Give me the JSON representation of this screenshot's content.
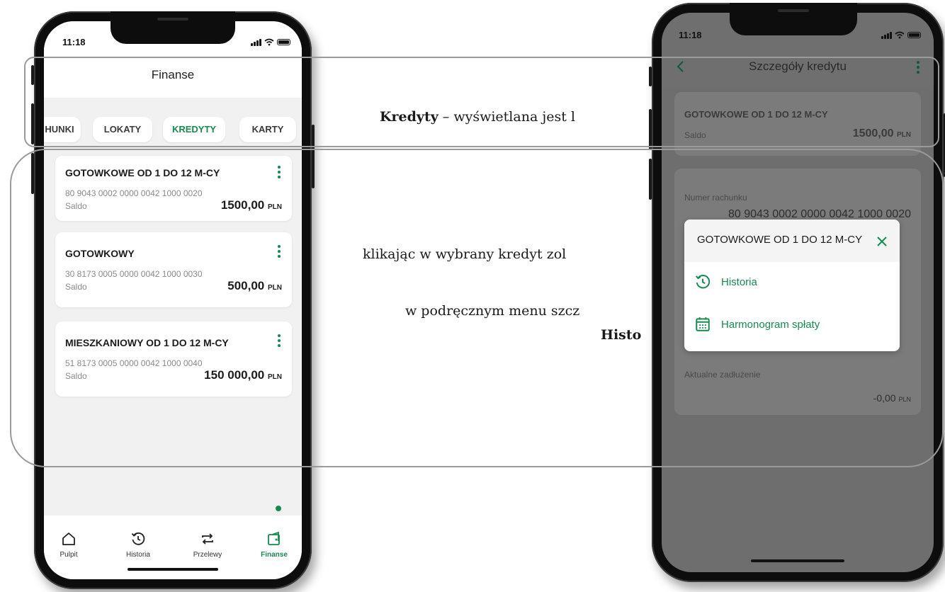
{
  "phone_left": {
    "time": "11:18",
    "title": "Finanse",
    "tabs": [
      "HUNKI",
      "LOKATY",
      "KREDYTY",
      "KARTY"
    ],
    "active_tab": "KREDYTY",
    "cards": [
      {
        "name": "GOTOWKOWE OD 1 DO 12 M-CY",
        "account": "80 9043 0002 0000 0042 1000 0020",
        "balance_label": "Saldo",
        "amount": "1500,00",
        "currency": "PLN"
      },
      {
        "name": "GOTOWKOWY",
        "account": "30 8173 0005 0000 0042 1000 0030",
        "balance_label": "Saldo",
        "amount": "500,00",
        "currency": "PLN"
      },
      {
        "name": "MIESZKANIOWY OD 1 DO 12 M-CY",
        "account": "51 8173 0005 0000 0042 1000 0040",
        "balance_label": "Saldo",
        "amount": "150 000,00",
        "currency": "PLN"
      }
    ],
    "nav": {
      "items": [
        {
          "label": "Pulpit",
          "icon": "home-icon"
        },
        {
          "label": "Historia",
          "icon": "history-icon"
        },
        {
          "label": "Przelewy",
          "icon": "transfer-icon"
        },
        {
          "label": "Finanse",
          "icon": "finance-icon"
        }
      ],
      "active": "Finanse"
    }
  },
  "phone_right": {
    "time": "11:18",
    "title": "Szczegóły kredytu",
    "summary": {
      "name": "GOTOWKOWE OD 1 DO 12 M-CY",
      "balance_label": "Saldo",
      "amount": "1500,00",
      "currency": "PLN"
    },
    "account_label": "Numer rachunku",
    "account_number": "80 9043 0002 0000 0042 1000 0020",
    "debt_label": "Aktualne zadłużenie",
    "debt_amount": "-0,00",
    "debt_currency": "PLN",
    "popup": {
      "title": "GOTOWKOWE OD 1 DO 12 M-CY",
      "items": [
        {
          "label": "Historia",
          "icon": "history-icon"
        },
        {
          "label": "Harmonogram spłaty",
          "icon": "calendar-icon"
        }
      ]
    }
  },
  "callout": {
    "line1_bold": "Kredyty",
    "line1_rest": " – wyświetlana jest l",
    "line2": "klikając w wybrany kredyt  zol",
    "line3": "w podręcznym menu szcz",
    "line4_bold": "Histo"
  },
  "colors": {
    "accent": "#168a4f",
    "overlay": "#6e6e6e"
  }
}
